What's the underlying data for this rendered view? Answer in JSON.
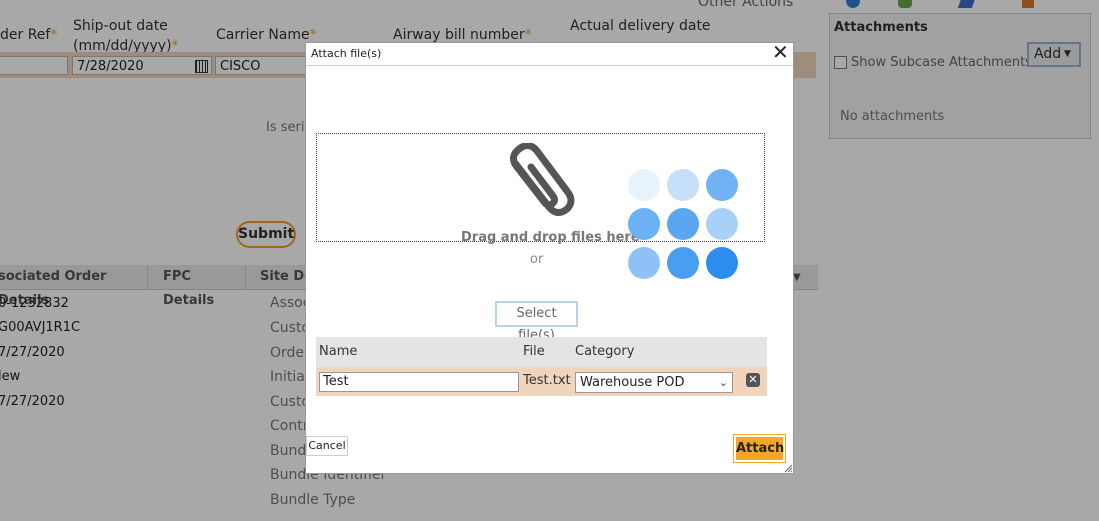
{
  "background": {
    "columns": {
      "order_ref": "der Ref",
      "ship_out_date": "Ship-out date",
      "ship_out_date_fmt": "(mm/dd/yyyy)",
      "carrier_name": "Carrier Name",
      "airway_bill": "Airway bill number",
      "actual_delivery": "Actual delivery date",
      "other_actions": "Other Actions"
    },
    "fields": {
      "ship_out_date_value": "7/28/2020",
      "carrier_value": "CISCO"
    },
    "serial_prompt": "Is seria",
    "submit_label": "Submit",
    "tabs": [
      "sociated Order Details",
      "FPC Details",
      "Site Det"
    ],
    "order_values": [
      "0-1232832",
      "G00AVJ1R1C",
      "7/27/2020",
      "lew",
      "7/27/2020"
    ],
    "site_labels": [
      "Assoc",
      "Custo",
      "Order",
      "Initial",
      "Custo",
      "Contr",
      "Bundle",
      "Bundle Identifier",
      "Bundle Type"
    ]
  },
  "attachments_panel": {
    "title": "Attachments",
    "show_subcase_label": "Show Subcase Attachments",
    "add_label": "Add",
    "empty_text": "No attachments"
  },
  "modal": {
    "title": "Attach file(s)",
    "dropzone_text": "Drag and drop files here",
    "or_text": "or",
    "select_files_label": "Select file(s)",
    "grid": {
      "headers": {
        "name": "Name",
        "file": "File",
        "category": "Category"
      },
      "row": {
        "name_value": "Test",
        "file": "Test.txt",
        "category": "Warehouse POD"
      }
    },
    "cancel_label": "Cancel",
    "attach_label": "Attach"
  },
  "colors": {
    "accent": "#f5a623",
    "required": "#f0a02c",
    "row_highlight": "#f0d5bc",
    "dot_light": "#e8f2fd",
    "dot_mid": "#a9d1f7",
    "dot_dark": "#2d8cf0"
  },
  "icons": [
    "paperclip-icon",
    "calendar-icon",
    "close-icon",
    "chevron-down-icon",
    "delete-icon",
    "caret-down-icon"
  ]
}
